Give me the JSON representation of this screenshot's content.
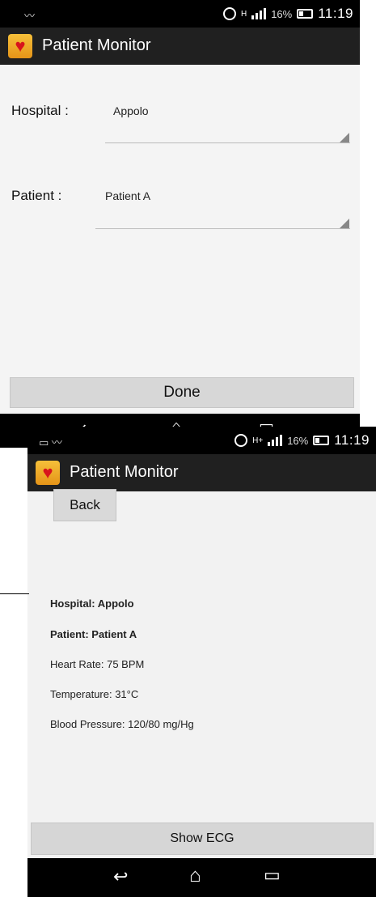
{
  "screen1": {
    "status": {
      "signal_label": "H",
      "battery_pct": "16%",
      "time": "11:19"
    },
    "app_title": "Patient Monitor",
    "hospital": {
      "label": "Hospital :",
      "value": "Appolo"
    },
    "patient": {
      "label": "Patient :",
      "value": "Patient A"
    },
    "done_label": "Done"
  },
  "screen2": {
    "status": {
      "signal_label": "H+",
      "battery_pct": "16%",
      "time": "11:19"
    },
    "app_title": "Patient Monitor",
    "back_label": "Back",
    "details": {
      "hospital": "Hospital: Appolo",
      "patient": "Patient: Patient A",
      "heart_rate": "Heart Rate: 75 BPM",
      "temperature": "Temperature: 31°C",
      "blood_pressure": "Blood Pressure: 120/80 mg/Hg"
    },
    "show_ecg_label": "Show ECG"
  },
  "icons": {
    "app_logo": "heart-logo-icon",
    "alarm": "alarm-clock-icon",
    "battery": "battery-icon",
    "signal": "signal-icon",
    "back_nav": "back-arrow-icon",
    "home_nav": "home-icon",
    "recents_nav": "recents-icon",
    "spinner": "dropdown-triangle-icon"
  },
  "colors": {
    "action_bar": "#202020",
    "status_bar": "#000000",
    "button": "#d7d7d7",
    "logo": "#f0a828",
    "heart": "#d8141c"
  }
}
